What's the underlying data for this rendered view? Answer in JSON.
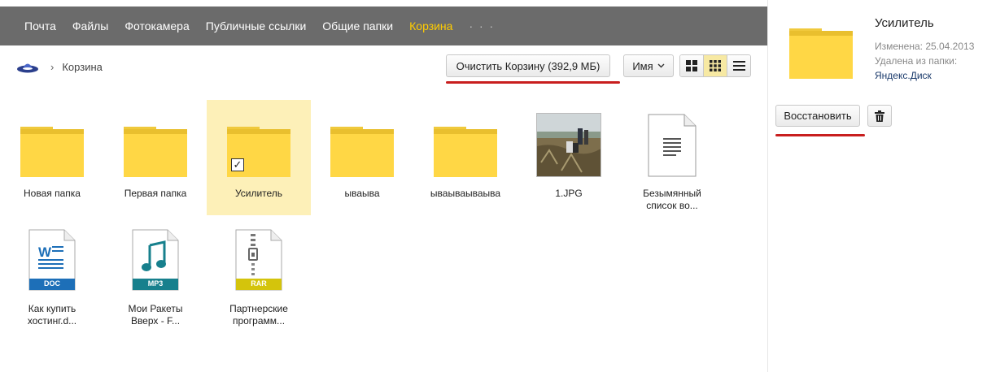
{
  "topnav": {
    "items": [
      {
        "label": "Почта"
      },
      {
        "label": "Файлы"
      },
      {
        "label": "Фотокамера"
      },
      {
        "label": "Публичные ссылки"
      },
      {
        "label": "Общие папки"
      },
      {
        "label": "Корзина",
        "active": true
      }
    ],
    "more": "· · ·",
    "active_color": "#ffcc00"
  },
  "breadcrumb": {
    "icon": "ufo-home-icon",
    "separator": "›",
    "current": "Корзина"
  },
  "toolbar": {
    "clear_label": "Очистить Корзину (392,9 МБ)",
    "sort_label": "Имя",
    "views": [
      "large-icons-view-icon",
      "small-icons-view-icon",
      "list-view-icon"
    ],
    "active_view": "small-icons-view-icon"
  },
  "files": [
    {
      "name": "Новая папка",
      "type": "folder"
    },
    {
      "name": "Первая папка",
      "type": "folder"
    },
    {
      "name": "Усилитель",
      "type": "folder",
      "selected": true
    },
    {
      "name": "ываыва",
      "type": "folder"
    },
    {
      "name": "ываываываыва",
      "type": "folder"
    },
    {
      "name": "1.JPG",
      "type": "image"
    },
    {
      "name_line1": "Безымянный",
      "name_line2": "список во...",
      "type": "text"
    },
    {
      "name_line1": "Как купить",
      "name_line2": "хостинг.d...",
      "type": "doc",
      "badge": "DOC"
    },
    {
      "name_line1": "Мои Ракеты",
      "name_line2": "Вверх - F...",
      "type": "mp3",
      "badge": "MP3"
    },
    {
      "name_line1": "Партнерские",
      "name_line2": "программ...",
      "type": "rar",
      "badge": "RAR"
    }
  ],
  "details": {
    "title": "Усилитель",
    "modified": "Изменена: 25.04.2013",
    "deleted_from": "Удалена из папки:",
    "folder": "Яндекс.Диск",
    "restore_label": "Восстановить",
    "trash_icon": "trash-icon"
  },
  "colors": {
    "nav_bg": "#6b6b6b",
    "folder": "#ffd745",
    "selected_bg": "#fdf0b8",
    "annotation_red": "#c81e1e"
  }
}
